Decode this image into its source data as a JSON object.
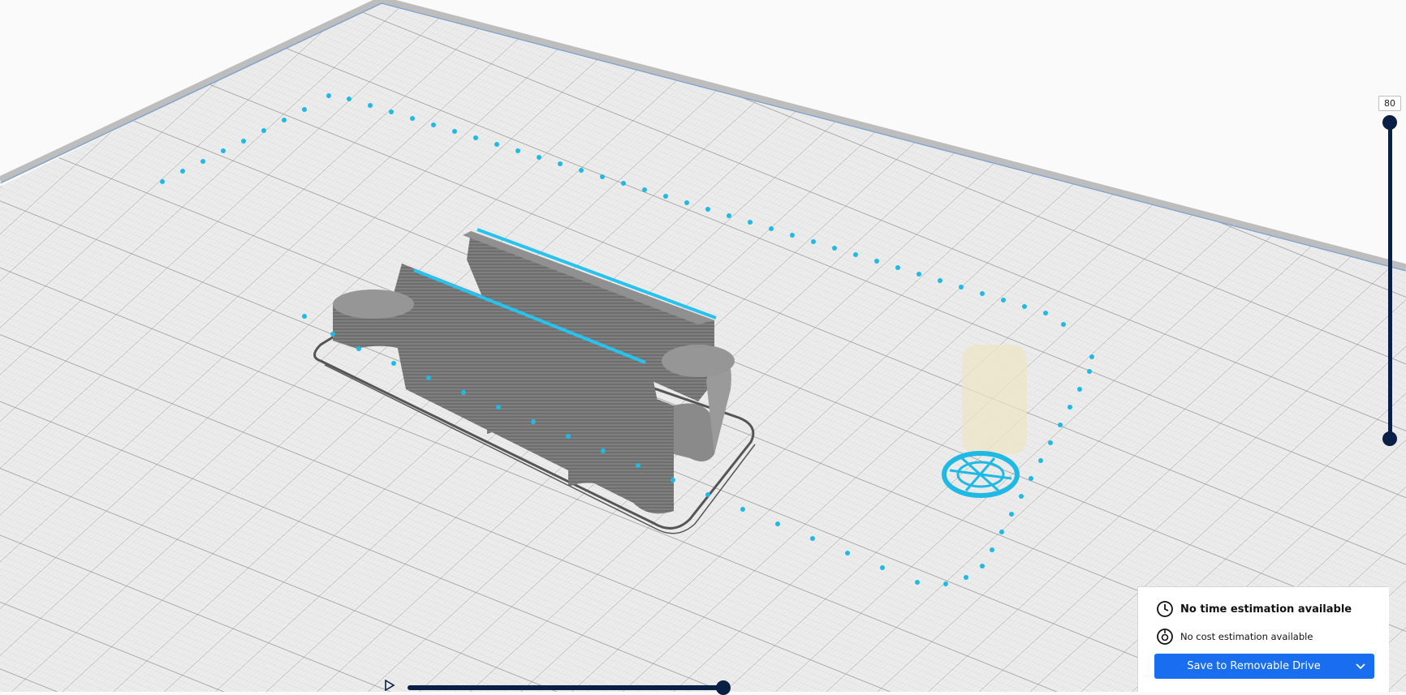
{
  "layer_slider": {
    "current_layer": "80",
    "max_fraction": 1.0,
    "min_fraction": 0.0
  },
  "path_slider": {
    "position_fraction": 1.0
  },
  "print_info": {
    "time_text": "No time estimation available",
    "cost_text": "No cost estimation available",
    "save_button_label": "Save to Removable Drive"
  },
  "icons": {
    "time": "clock-icon",
    "cost": "cost-icon",
    "play": "play-icon",
    "dropdown": "chevron-down-icon"
  },
  "colors": {
    "plate": "#f1f1f1",
    "grid": "#8a8a8a",
    "model": "#7a7a7a",
    "support": "#1fb9e6",
    "accent": "#196ef0",
    "slider": "#0a1f44"
  }
}
